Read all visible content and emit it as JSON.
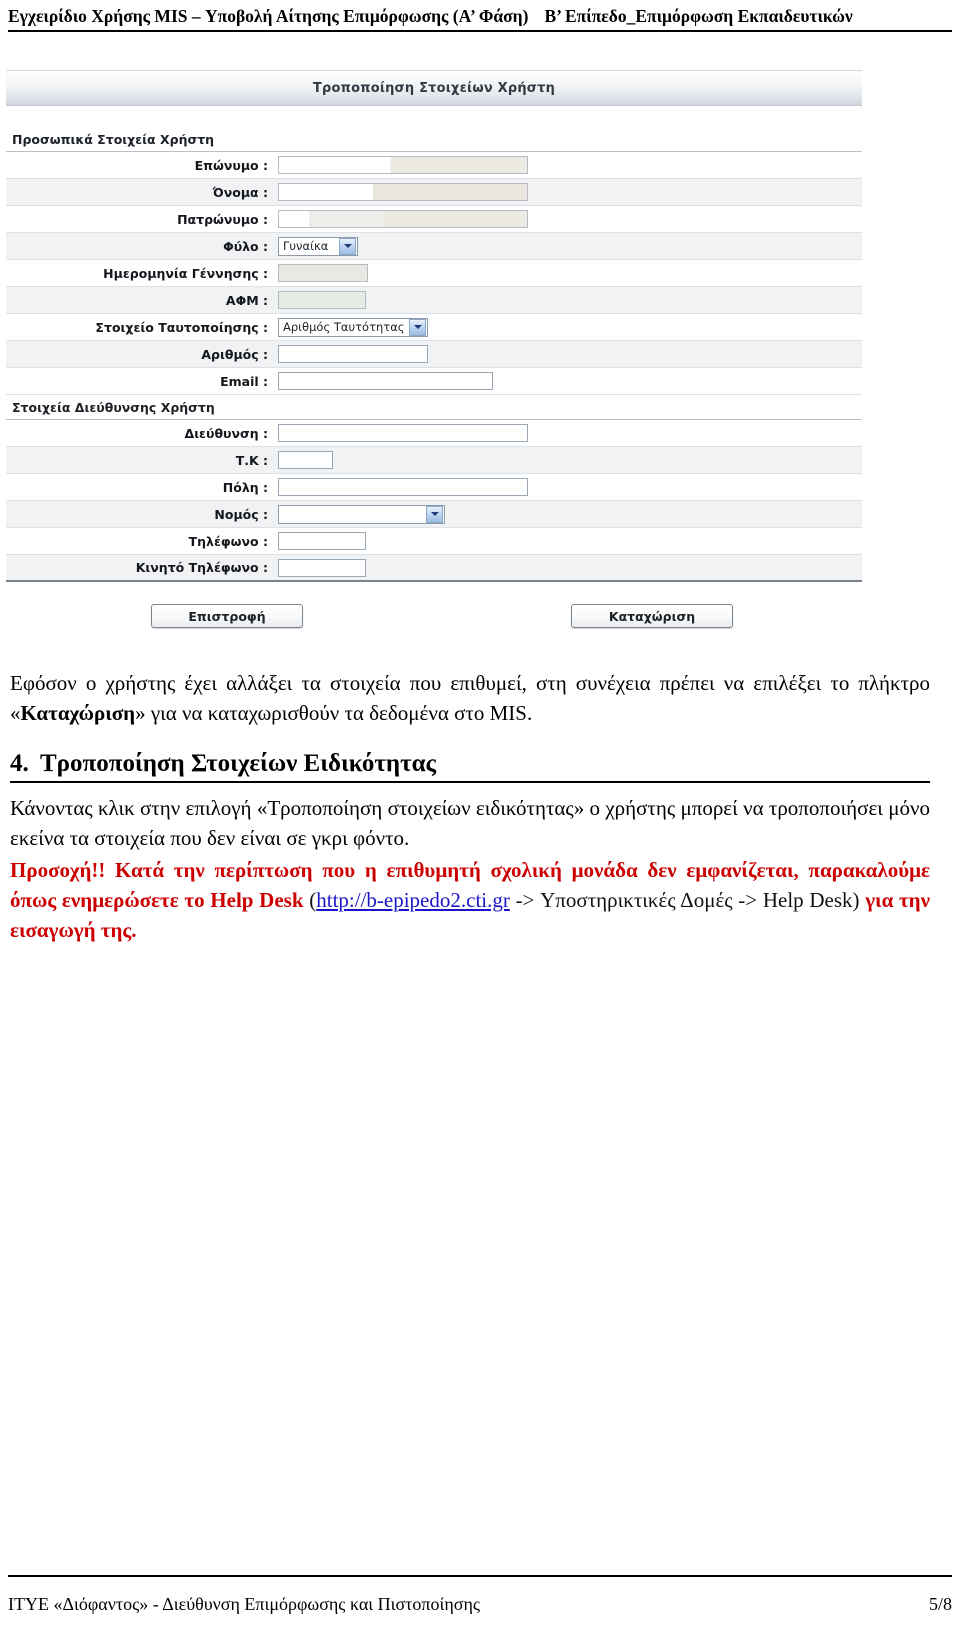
{
  "header": {
    "left": "Εγχειρίδιο Χρήσης MIS – Υποβολή Αίτησης Επιμόρφωσης (Α’ Φάση)",
    "right": "Β’ Επίπεδο_Επιμόρφωση Εκπαιδευτικών"
  },
  "screenshot": {
    "title": "Τροποποίηση Στοιχείων Χρήστη",
    "section_personal": "Προσωπικά Στοιχεία Χρήστη",
    "section_address": "Στοιχεία Διεύθυνσης Χρήστη",
    "fields": {
      "lastname": "Επώνυμο :",
      "firstname": "Όνομα :",
      "fathername": "Πατρώνυμο :",
      "gender": "Φύλο :",
      "birthdate": "Ημερομηνία Γέννησης :",
      "afm": "ΑΦΜ :",
      "idtype": "Στοιχείο Ταυτοποίησης :",
      "idnumber": "Αριθμός :",
      "email": "Email :",
      "address": "Διεύθυνση :",
      "postcode": "Τ.Κ :",
      "city": "Πόλη :",
      "prefecture": "Νομός :",
      "phone": "Τηλέφωνο :",
      "mobile": "Κινητό Τηλέφωνο :"
    },
    "values": {
      "gender": "Γυναίκα",
      "idtype": "Αριθμός Ταυτότητας",
      "prefecture": ""
    },
    "buttons": {
      "back": "Επιστροφή",
      "submit": "Καταχώριση"
    }
  },
  "body": {
    "p1_a": "Εφόσον ο χρήστης έχει αλλάξει τα στοιχεία που επιθυμεί, στη συνέχεια πρέπει να επιλέξει το πλήκτρο «",
    "p1_b": "Καταχώριση",
    "p1_c": "» για να καταχωρισθούν τα δεδομένα στο MIS.",
    "section_number": "4.",
    "section_title": "Τροποποίηση Στοιχείων Ειδικότητας",
    "p2": "Κάνοντας κλικ στην επιλογή «Τροποποίηση στοιχείων ειδικότητας» ο χρήστης μπορεί να τροποποιήσει μόνο εκείνα τα στοιχεία που δεν είναι σε γκρι φόντο.",
    "p3_red1": "Προσοχή!! Κατά την περίπτωση που η επιθυμητή σχολική μονάδα δεν εμφανίζεται, παρακαλούμε όπως ενημερώσετε το Help Desk",
    "p3_paren_open": " (",
    "p3_link": "http://b-epipedo2.cti.gr",
    "p3_black": " -> Υποστηρικτικές Δομές -> Help Desk)",
    "p3_red2": " για την εισαγωγή της."
  },
  "footer": {
    "left": "ΙΤΥΕ «Διόφαντος» - Διεύθυνση Επιμόρφωσης και Πιστοποίησης",
    "right": "5/8"
  },
  "colors": {
    "red": "#cc0000",
    "link": "#1a16c8",
    "form_header_bg": "#dfe4ea",
    "row_alt": "#f1f2f4"
  }
}
